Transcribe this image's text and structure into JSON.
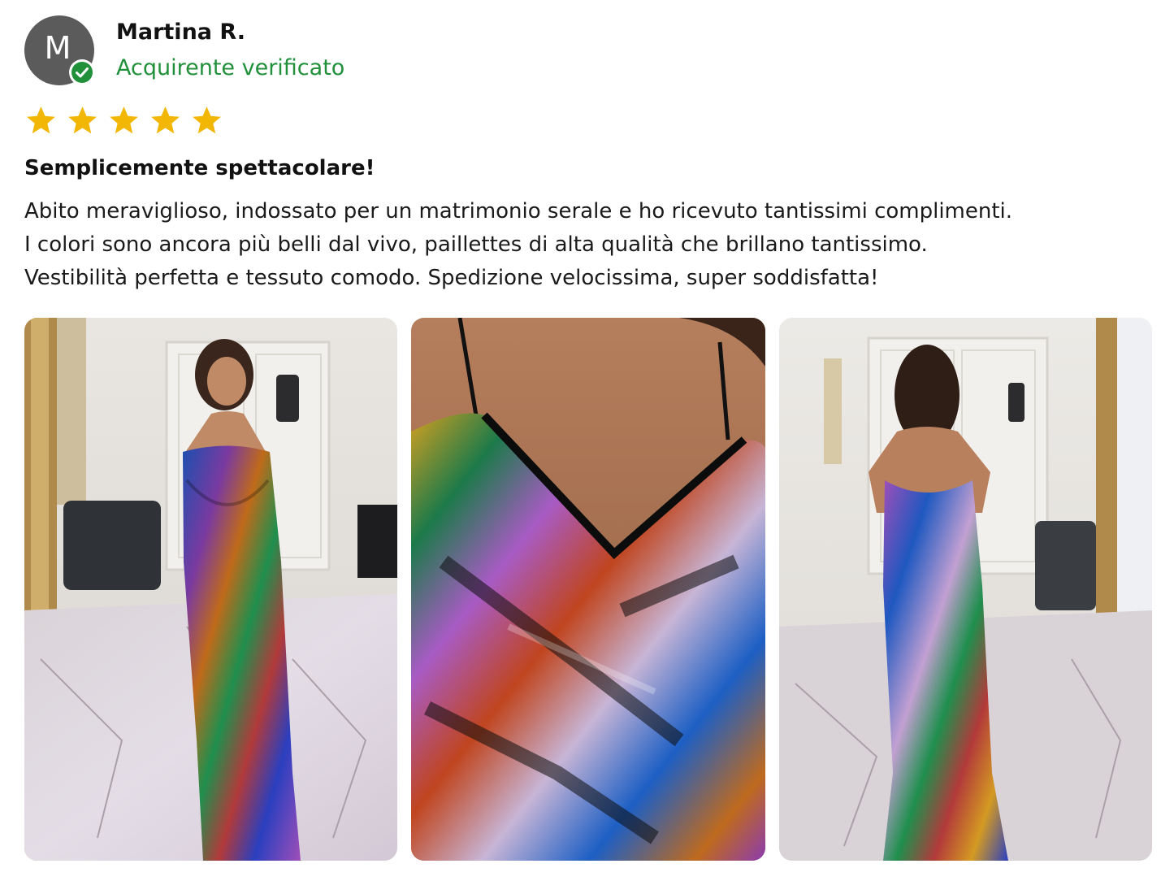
{
  "reviewer": {
    "initial": "M",
    "name": "Martina R.",
    "verified_label": "Acquirente verificato",
    "verified_icon": "check-circle-icon",
    "avatar_color": "#5b5b5b",
    "verified_color": "#21903a"
  },
  "rating": {
    "value": 5,
    "max": 5,
    "icon": "star-icon",
    "star_color": "#f2b705"
  },
  "review": {
    "title": "Semplicemente spettacolare!",
    "lines": [
      "Abito meraviglioso, indossato per un matrimonio serale e ho ricevuto tantissimi complimenti.",
      "I colori sono ancora più belli dal vivo, paillettes di alta qualità che brillano tantissimo.",
      "Vestibilità perfetta e tessuto comodo. Spedizione velocissima, super soddisfatta!"
    ]
  },
  "photos": [
    {
      "icon": "photo-mirror-selfie-front"
    },
    {
      "icon": "photo-dress-neckline-closeup"
    },
    {
      "icon": "photo-mirror-selfie-back"
    }
  ]
}
